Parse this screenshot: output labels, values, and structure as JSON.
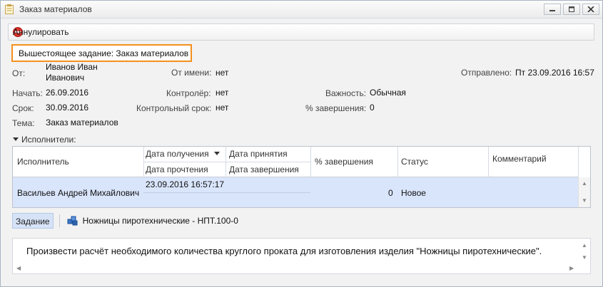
{
  "window": {
    "title": "Заказ материалов"
  },
  "toolbar": {
    "cancel_label": "Аннулировать"
  },
  "parent_task": "Вышестоящее задание: Заказ материалов",
  "fields": {
    "from_label": "От:",
    "from_value_line1": "Иванов Иван",
    "from_value_line2": "Иванович",
    "on_behalf_label": "От имени:",
    "on_behalf_value": "нет",
    "sent_label": "Отправлено:",
    "sent_value": "Пт 23.09.2016 16:57",
    "start_label": "Начать:",
    "start_value": "26.09.2016",
    "controller_label": "Контролёр:",
    "controller_value": "нет",
    "importance_label": "Важность:",
    "importance_value": "Обычная",
    "due_label": "Срок:",
    "due_value": "30.09.2016",
    "control_due_label": "Контрольный срок:",
    "control_due_value": "нет",
    "completion_label": "% завершения:",
    "completion_value": "0",
    "subject_label": "Тема:",
    "subject_value": "Заказ материалов"
  },
  "executors": {
    "section_label": "Исполнители:",
    "headers": {
      "executor": "Исполнитель",
      "received": "Дата получения",
      "accepted": "Дата принятия",
      "read": "Дата прочтения",
      "finished": "Дата завершения",
      "completion": "% завершения",
      "status": "Статус",
      "comment": "Комментарий"
    },
    "rows": [
      {
        "executor": "Васильев Андрей Михайлович",
        "received": "23.09.2016 16:57:17",
        "accepted": "",
        "read": "",
        "finished": "",
        "completion": "0",
        "status": "Новое",
        "comment": ""
      }
    ]
  },
  "tabs": {
    "task_tab": "Задание",
    "object_link": "Ножницы пиротехнические - НПТ.100-0"
  },
  "description": "Произвести расчёт необходимого количества круглого проката для изготовления изделия \"Ножницы пиротехнические\".",
  "colors": {
    "accent_orange": "#f5901e",
    "selection": "#d9e5fb",
    "cancel_red": "#d9322b"
  }
}
